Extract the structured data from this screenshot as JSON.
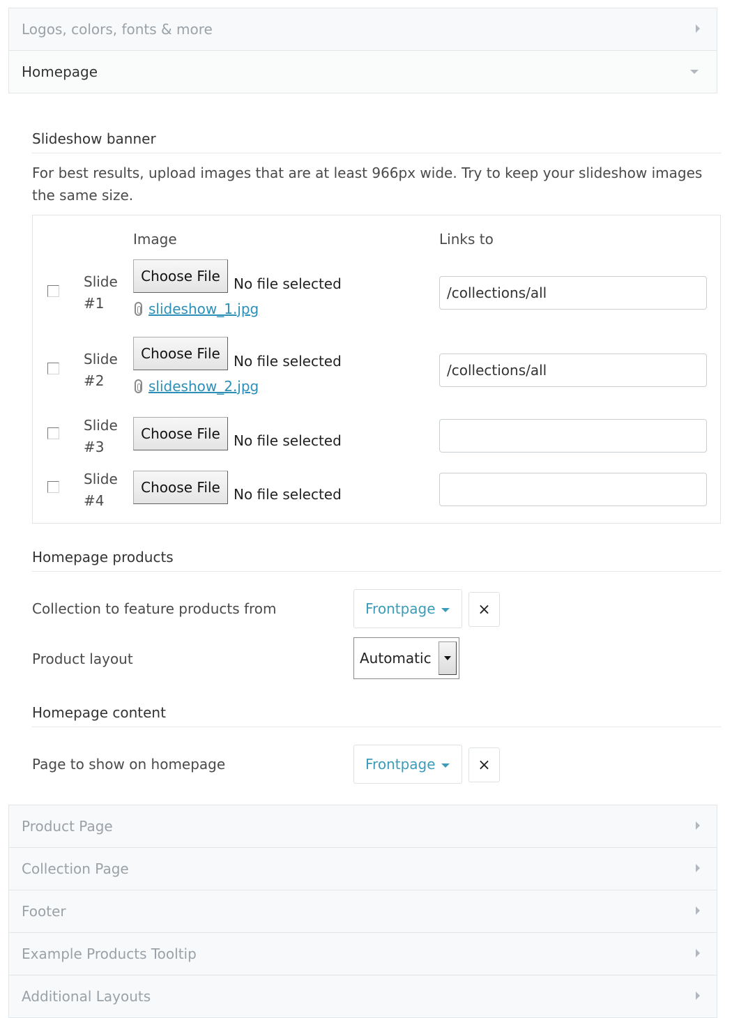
{
  "accordion_top": [
    {
      "label": "Logos, colors, fonts & more",
      "state": "collapsed"
    },
    {
      "label": "Homepage",
      "state": "expanded"
    }
  ],
  "homepage": {
    "slideshow": {
      "title": "Slideshow banner",
      "help": "For best results, upload images that are at least 966px wide. Try to keep your slideshow images the same size.",
      "col_image": "Image",
      "col_links": "Links to",
      "choose_file_label": "Choose File",
      "no_file_text": "No file selected",
      "slides": [
        {
          "label": "Slide #1",
          "file": "slideshow_1.jpg",
          "link": "/collections/all",
          "checked": false
        },
        {
          "label": "Slide #2",
          "file": "slideshow_2.jpg",
          "link": "/collections/all",
          "checked": false
        },
        {
          "label": "Slide #3",
          "file": "",
          "link": "",
          "checked": false
        },
        {
          "label": "Slide #4",
          "file": "",
          "link": "",
          "checked": false
        }
      ]
    },
    "products": {
      "title": "Homepage products",
      "collection_label": "Collection to feature products from",
      "collection_value": "Frontpage",
      "layout_label": "Product layout",
      "layout_value": "Automatic"
    },
    "content": {
      "title": "Homepage content",
      "page_label": "Page to show on homepage",
      "page_value": "Frontpage"
    },
    "clear_symbol": "×"
  },
  "accordion_bottom": [
    {
      "label": "Product Page",
      "state": "collapsed"
    },
    {
      "label": "Collection Page",
      "state": "collapsed"
    },
    {
      "label": "Footer",
      "state": "collapsed"
    },
    {
      "label": "Example Products Tooltip",
      "state": "collapsed"
    },
    {
      "label": "Additional Layouts",
      "state": "collapsed"
    }
  ],
  "colors": {
    "accent": "#3b9bb8",
    "link": "#2b8fb8",
    "muted": "#9aa1a7"
  }
}
